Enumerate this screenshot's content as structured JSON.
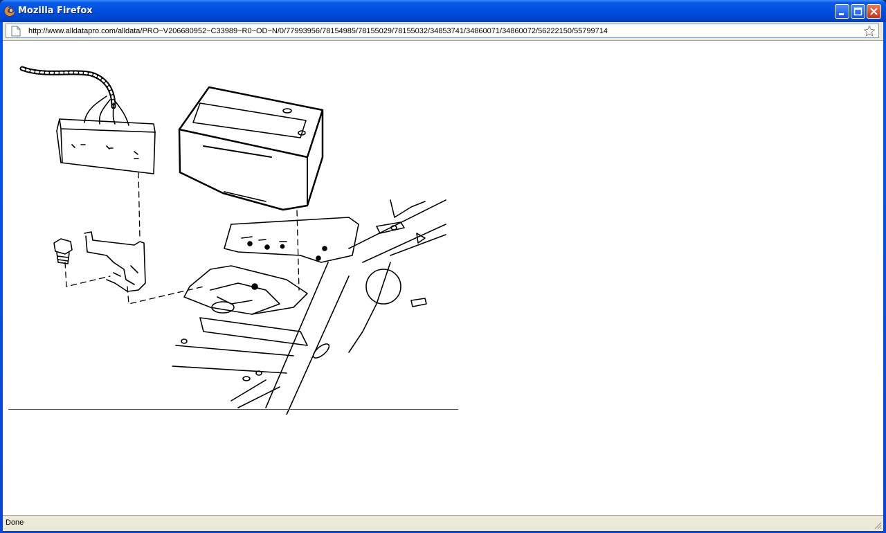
{
  "window": {
    "title": "Mozilla Firefox"
  },
  "titlebar_buttons": {
    "minimize_icon": "minimize-icon",
    "maximize_icon": "maximize-icon",
    "close_icon": "close-icon"
  },
  "navbar": {
    "url": "http://www.alldatapro.com/alldata/PRO~V206680952~C33989~R0~OD~N/0/77993956/78154985/78155029/78155032/34853741/34860071/34860072/56222150/55799714",
    "page_icon": "page-icon",
    "bookmark_icon": "star-icon"
  },
  "content": {
    "image_kind": "technical line drawing"
  },
  "statusbar": {
    "text": "Done"
  }
}
